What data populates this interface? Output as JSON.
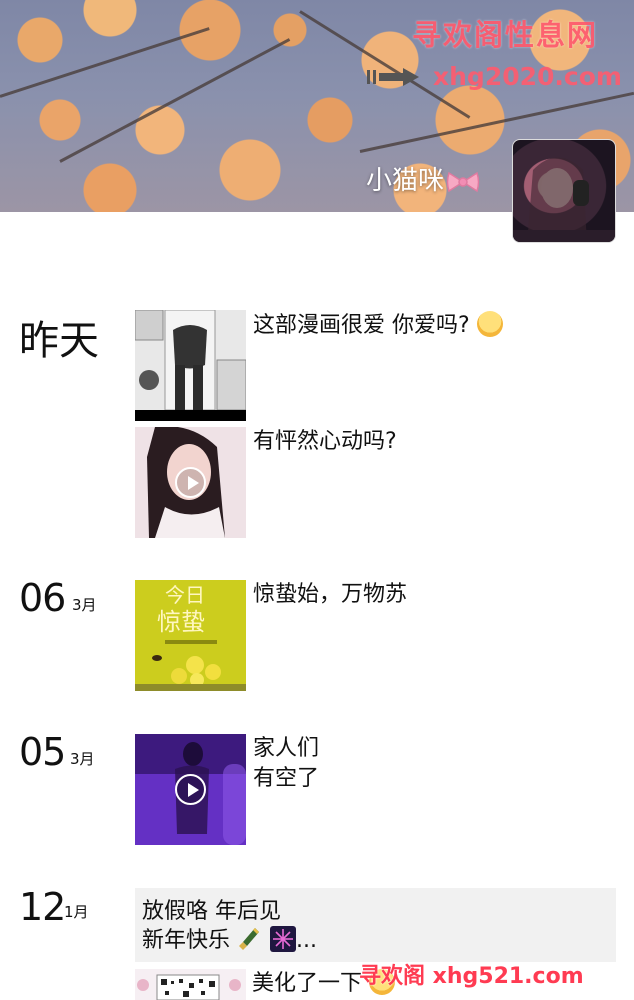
{
  "cover": {
    "watermark_cn": "寻欢阁性息网",
    "watermark_url": "xhg2020.com",
    "nickname": "小猫咪",
    "nickname_emoji": "bow-icon"
  },
  "avatar": {
    "icon": "avatar-photo"
  },
  "feed": [
    {
      "date_label": "昨天",
      "posts": [
        {
          "thumb": "manga-image",
          "text": "这部漫画很爱 你爱吗?",
          "emoji": "drooling-face-icon",
          "video": false
        },
        {
          "thumb": "girl-portrait-video",
          "text": "有怦然心动吗?",
          "video": true
        }
      ]
    },
    {
      "day": "06",
      "month": "3月",
      "posts": [
        {
          "thumb": "jingzhe-poster",
          "text": "惊蛰始，万物苏",
          "video": false
        }
      ]
    },
    {
      "day": "05",
      "month": "3月",
      "posts": [
        {
          "thumb": "purple-room-video",
          "text_line1": "家人们",
          "text_line2": "有空了",
          "video": true
        }
      ]
    },
    {
      "day": "12",
      "month": "1月",
      "posts": [
        {
          "type": "text-only",
          "text_line1": "放假咯 年后见",
          "text_line2": "新年快乐",
          "text_suffix": "...",
          "emojis": [
            "champagne-icon",
            "fireworks-icon"
          ]
        },
        {
          "thumb": "qr-code-image",
          "text": "美化了一下",
          "emoji": "smiling-face-icon",
          "video": false
        }
      ]
    }
  ],
  "bottom_watermark": "寻欢阁 xhg521.com",
  "colors": {
    "watermark": "#ff5b6e",
    "card_bg": "#f1f1f1",
    "text": "#111111"
  }
}
